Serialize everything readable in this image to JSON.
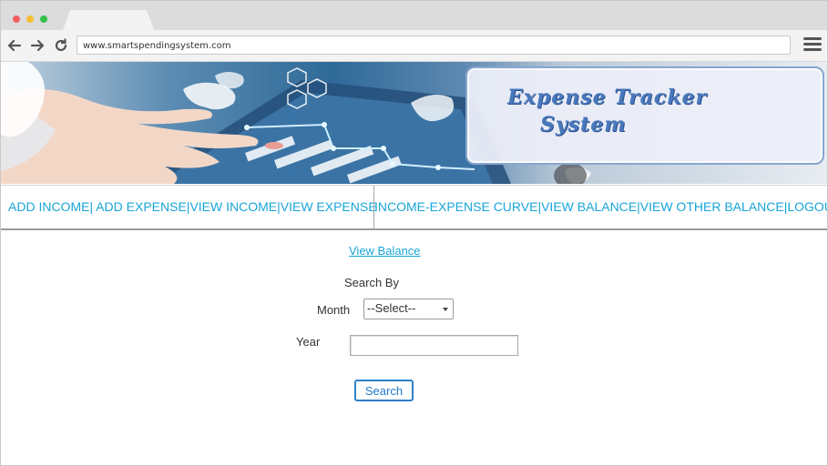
{
  "browser": {
    "url": "www.smartspendingsystem.com"
  },
  "banner": {
    "title_line1": "Expense   Tracker",
    "title_line2": "System"
  },
  "nav": {
    "left_items": [
      "ADD INCOME",
      " ADD EXPENSE",
      "VIEW INCOME",
      "VIEW EXPENSE"
    ],
    "right_items": [
      "INCOME-EXPENSE CURVE",
      "VIEW BALANCE",
      "VIEW OTHER BALANCE",
      "LOGOUT"
    ],
    "separator": "|"
  },
  "form": {
    "link_label": "View Balance",
    "search_by_label": "Search By",
    "month_label": "Month",
    "month_selected": "--Select--",
    "year_label": "Year",
    "year_value": "",
    "search_button": "Search"
  },
  "colors": {
    "link": "#19a5d9",
    "title": "#4a78bc",
    "button_border": "#2f7fc7"
  },
  "icons": {
    "back": "arrow-left-icon",
    "forward": "arrow-right-icon",
    "reload": "reload-icon",
    "menu": "hamburger-menu-icon"
  }
}
